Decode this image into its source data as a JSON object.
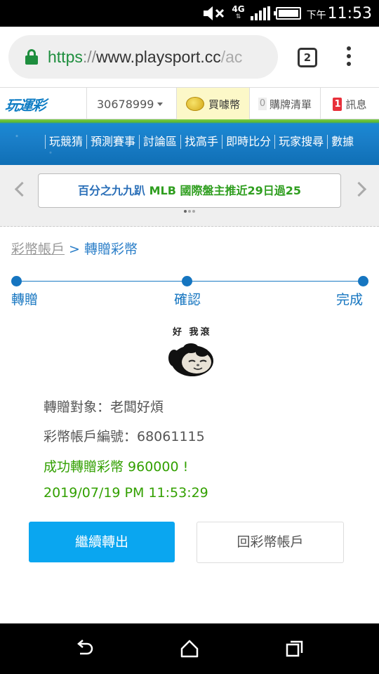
{
  "status_bar": {
    "network": "4G",
    "ampm": "下午",
    "time": "11:53",
    "icons": [
      "mute-icon",
      "network-4g-icon",
      "signal-icon",
      "battery-icon"
    ]
  },
  "browser": {
    "url_scheme": "https",
    "url_sep": "://",
    "url_host": "www.playsport.cc",
    "url_rest": "/ac",
    "tab_count": "2"
  },
  "site_header": {
    "logo_text": "玩運彩",
    "account_id": "30678999",
    "buy_coin": "買噱幣",
    "coin_icon_text": "幣",
    "cart_count": "0",
    "cart_label": "購牌清單",
    "msg_count": "1",
    "msg_label": "訊息"
  },
  "nav": {
    "items": [
      "玩競猜",
      "預測賽事",
      "討論區",
      "找高手",
      "即時比分",
      "玩家搜尋",
      "數據"
    ]
  },
  "marquee": {
    "text_prefix": "百分之九九趴 ",
    "text_highlight": "MLB 國際盤主推近29日過25"
  },
  "breadcrumb": {
    "parent": "彩幣帳戶",
    "separator": " > ",
    "current": "轉贈彩幣"
  },
  "steps": [
    {
      "label": "轉贈"
    },
    {
      "label": "確認"
    },
    {
      "label": "完成"
    }
  ],
  "avatar": {
    "caption": "好 我滾"
  },
  "details": {
    "recipient": "轉贈對象：老闆好煩",
    "account_no": "彩幣帳戶編號：68061115",
    "success_message": "成功轉贈彩幣 960000 !",
    "timestamp": "2019/07/19 PM 11:53:29"
  },
  "buttons": {
    "continue": "繼續轉出",
    "back": "回彩幣帳戶"
  },
  "colors": {
    "primary_blue": "#0aa6f0",
    "step_blue": "#1575c0",
    "success_green": "#32a000",
    "url_green": "#1e8e3e"
  }
}
